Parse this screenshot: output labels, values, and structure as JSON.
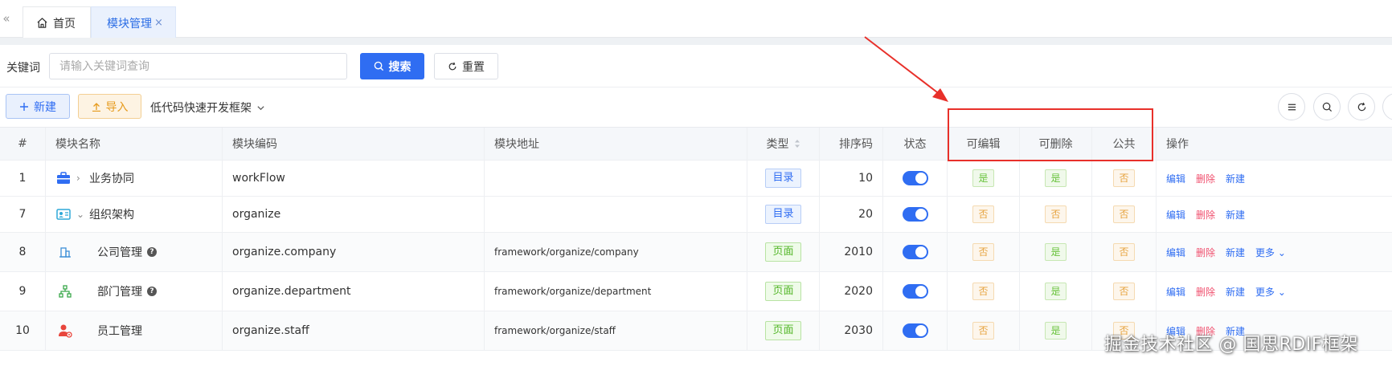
{
  "tabs": {
    "home_label": "首页",
    "module_label": "模块管理",
    "close_glyph": "×",
    "collapse_glyph": "«"
  },
  "search": {
    "label": "关键词",
    "placeholder": "请输入关键词查询",
    "value": "",
    "search_button": "搜索",
    "reset_button": "重置"
  },
  "toolbar": {
    "new_button": "新建",
    "import_button": "导入",
    "project_select": "低代码快速开发框架"
  },
  "table": {
    "columns": {
      "idx": "#",
      "name": "模块名称",
      "code": "模块编码",
      "addr": "模块地址",
      "type": "类型",
      "sort": "排序码",
      "status": "状态",
      "editable": "可编辑",
      "deletable": "可删除",
      "public": "公共",
      "ops": "操作"
    },
    "rows": [
      {
        "idx": "1",
        "name": "业务协同",
        "code": "workFlow",
        "addr": "",
        "type": "目录",
        "sort": "10",
        "editable": "是",
        "deletable": "是",
        "public": "否",
        "ops": [
          "编辑",
          "删除",
          "新建"
        ],
        "more": ""
      },
      {
        "idx": "7",
        "name": "组织架构",
        "code": "organize",
        "addr": "",
        "type": "目录",
        "sort": "20",
        "editable": "否",
        "deletable": "否",
        "public": "否",
        "ops": [
          "编辑",
          "删除",
          "新建"
        ],
        "more": ""
      },
      {
        "idx": "8",
        "name": "公司管理",
        "code": "organize.company",
        "addr": "framework/organize/company",
        "type": "页面",
        "sort": "2010",
        "editable": "否",
        "deletable": "是",
        "public": "否",
        "ops": [
          "编辑",
          "删除",
          "新建"
        ],
        "more": "更多"
      },
      {
        "idx": "9",
        "name": "部门管理",
        "code": "organize.department",
        "addr": "framework/organize/department",
        "type": "页面",
        "sort": "2020",
        "editable": "否",
        "deletable": "是",
        "public": "否",
        "ops": [
          "编辑",
          "删除",
          "新建"
        ],
        "more": "更多"
      },
      {
        "idx": "10",
        "name": "员工管理",
        "code": "organize.staff",
        "addr": "framework/organize/staff",
        "type": "页面",
        "sort": "2030",
        "editable": "否",
        "deletable": "是",
        "public": "否",
        "ops": [
          "编辑",
          "删除",
          "新建"
        ],
        "more": ""
      }
    ]
  },
  "icons": {
    "row1": "briefcase-icon",
    "row2": "id-card-icon",
    "row3": "building-icon",
    "row4": "org-tree-icon",
    "row5": "user-gear-icon"
  },
  "colors": {
    "primary": "#2f6df2",
    "danger": "#f0506e",
    "highlight": "#e8302a"
  },
  "watermark": "掘金技术社区 @ 国思RDIF框架"
}
